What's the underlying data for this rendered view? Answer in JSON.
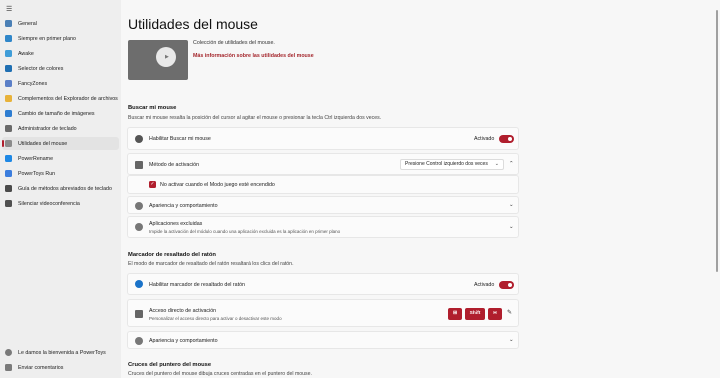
{
  "colors": {
    "accent": "#b01e2d",
    "link": "#a4262c"
  },
  "sidebar": {
    "menu_icon": "hamburger-icon",
    "items": [
      {
        "label": "General",
        "icon": "gear-icon",
        "color": "#4a7fb5"
      },
      {
        "label": "Siempre en primer plano",
        "icon": "pin-window-icon",
        "color": "#2f86c9"
      },
      {
        "label": "Awake",
        "icon": "coffee-icon",
        "color": "#3f9dd8"
      },
      {
        "label": "Selector de colores",
        "icon": "color-picker-icon",
        "color": "#1f6fb2"
      },
      {
        "label": "FancyZones",
        "icon": "zones-icon",
        "color": "#5b7fc7"
      },
      {
        "label": "Complementos del Explorador de archivos",
        "icon": "folder-icon",
        "color": "#e8b23a"
      },
      {
        "label": "Cambio de tamaño de imágenes",
        "icon": "image-resize-icon",
        "color": "#2e7dd1"
      },
      {
        "label": "Administrador de teclado",
        "icon": "keyboard-icon",
        "color": "#6a6a6a"
      },
      {
        "label": "Utilidades del mouse",
        "icon": "mouse-icon",
        "color": "#8a8a8a"
      },
      {
        "label": "PowerRename",
        "icon": "rename-icon",
        "color": "#1e88e5"
      },
      {
        "label": "PowerToys Run",
        "icon": "run-icon",
        "color": "#3b7ddd"
      },
      {
        "label": "Guía de métodos abreviados de teclado",
        "icon": "shortcut-guide-icon",
        "color": "#4a4a4a"
      },
      {
        "label": "Silenciar videoconferencia",
        "icon": "camera-mute-icon",
        "color": "#505050"
      }
    ],
    "footer": [
      {
        "label": "Le damos la bienvenida a PowerToys",
        "icon": "welcome-icon"
      },
      {
        "label": "Enviar comentarios",
        "icon": "feedback-icon"
      }
    ]
  },
  "main": {
    "title": "Utilidades del mouse",
    "hero_description": "Colección de utilidades del mouse.",
    "hero_link": "Más información sobre las utilidades del mouse",
    "find_mouse": {
      "title": "Buscar mi mouse",
      "description": "Buscar mi mouse resalta la posición del cursor al agitar el mouse o presionar la tecla Ctrl izquierda dos veces.",
      "enable_label": "Habilitar Buscar mi mouse",
      "enable_state": "Activado",
      "activation_label": "Método de activación",
      "activation_value": "Presione Control izquierdo dos veces",
      "game_mode_label": "No activar cuando el Modo juego esté encendido",
      "appearance_label": "Apariencia y comportamiento",
      "excluded_label": "Aplicaciones excluidas",
      "excluded_sub": "Impide la activación del módulo cuando una aplicación excluida es la aplicación en primer plano"
    },
    "highlighter": {
      "title": "Marcador de resaltado del ratón",
      "description": "El modo de marcador de resaltado del ratón resaltará los clics del ratón.",
      "enable_label": "Habilitar marcador de resaltado del ratón",
      "enable_state": "Activado",
      "shortcut_label": "Acceso directo de activación",
      "shortcut_sub": "Personalizar el acceso directo para activar o desactivar este modo",
      "keys": [
        "⊞",
        "Shift",
        "H"
      ],
      "appearance_label": "Apariencia y comportamiento"
    },
    "crosshairs": {
      "title": "Cruces del puntero del mouse",
      "description": "Cruces del puntero del mouse dibuja cruces centradas en el puntero del mouse."
    }
  }
}
